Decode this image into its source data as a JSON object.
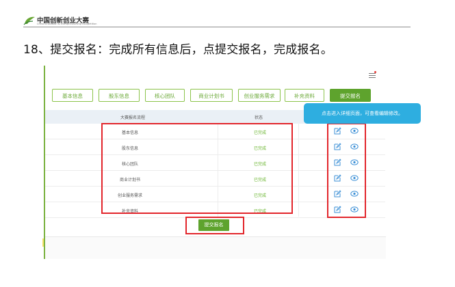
{
  "logo": {
    "title": "中国创新创业大赛",
    "subtitle": "China Innovation & Entrepreneurship Competition"
  },
  "heading": "18、提交报名：完成所有信息后，点提交报名，完成报名。",
  "tabs": [
    {
      "label": "基本信息",
      "active": false
    },
    {
      "label": "股东信息",
      "active": false
    },
    {
      "label": "核心团队",
      "active": false
    },
    {
      "label": "商业计划书",
      "active": false
    },
    {
      "label": "创业服务需求",
      "active": false
    },
    {
      "label": "补充资料",
      "active": false
    },
    {
      "label": "提交报名",
      "active": true
    }
  ],
  "table": {
    "headers": {
      "process": "大赛报名流程",
      "status": "状态"
    },
    "rows": [
      {
        "name": "基本信息",
        "status": "已完成"
      },
      {
        "name": "股东信息",
        "status": "已完成"
      },
      {
        "name": "核心团队",
        "status": "已完成"
      },
      {
        "name": "商业计划书",
        "status": "已完成"
      },
      {
        "name": "创业服务需求",
        "status": "已完成"
      },
      {
        "name": "补充资料",
        "status": "已完成"
      }
    ]
  },
  "tooltip": "点击进入详细页面，可查看编辑修改。",
  "submit_label": "提交报名",
  "icons": {
    "edit": "edit-icon",
    "view": "eye-icon",
    "menu": "menu-icon"
  },
  "colors": {
    "accent": "#5ea32d",
    "status": "#69b52f",
    "highlight": "#e2242a",
    "tooltip": "#2eaee0"
  }
}
